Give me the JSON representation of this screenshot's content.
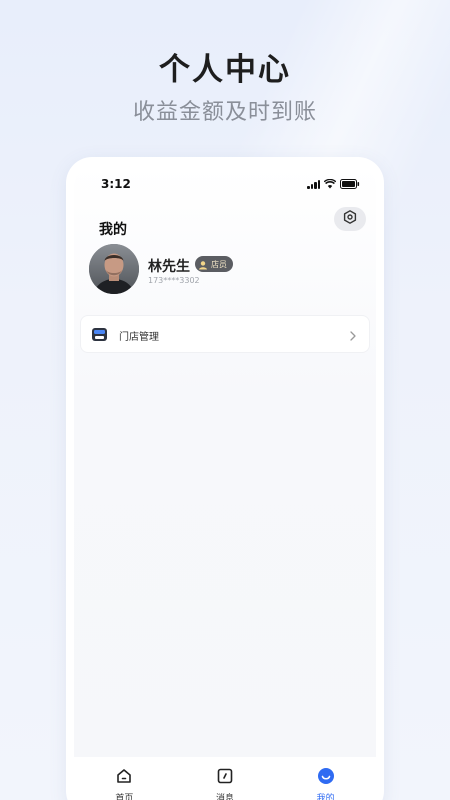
{
  "promo": {
    "headline": "个人中心",
    "subline": "收益金额及时到账"
  },
  "status_bar": {
    "time": "3:12"
  },
  "header": {
    "title": "我的",
    "settings_icon": "settings-hexagon-icon"
  },
  "profile": {
    "name": "林先生",
    "role_badge": "店员",
    "phone": "173****3302"
  },
  "menu": {
    "items": [
      {
        "label": "门店管理",
        "icon": "store-icon"
      }
    ]
  },
  "tabbar": {
    "tabs": [
      {
        "label": "首页",
        "icon": "home-icon",
        "active": false
      },
      {
        "label": "消息",
        "icon": "message-icon",
        "active": false
      },
      {
        "label": "我的",
        "icon": "profile-icon",
        "active": true
      }
    ]
  },
  "colors": {
    "accent": "#2f6bf2",
    "badge_bg": "#5b5d62",
    "background": "#eef2fb"
  }
}
